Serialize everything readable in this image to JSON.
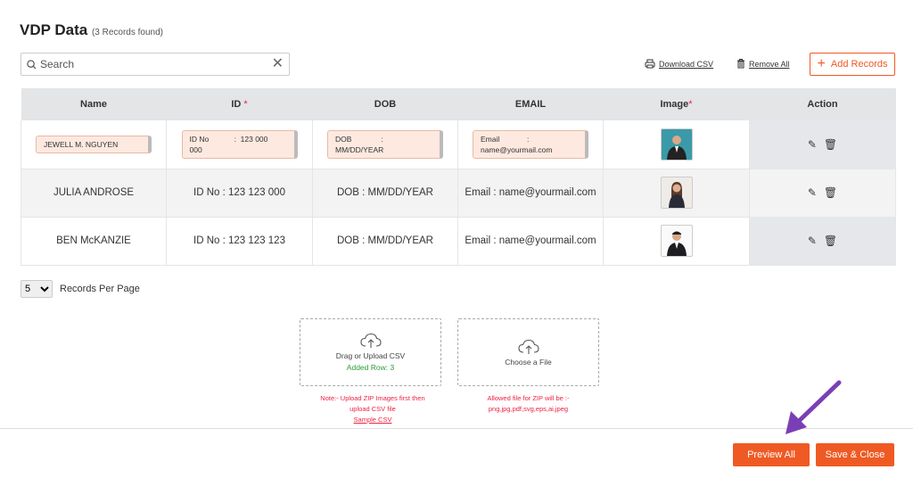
{
  "modal": {
    "title": "VDP Data",
    "record_count": "(3 Records found)",
    "close_glyph": "ˇ"
  },
  "search": {
    "placeholder": "Search"
  },
  "toolbar": {
    "download_csv": "Download CSV",
    "remove_all": "Remove All",
    "add_records": "Add Records"
  },
  "table": {
    "headers": {
      "name": "Name",
      "id": "ID",
      "dob": "DOB",
      "email": "EMAIL",
      "image": "Image",
      "action": "Action"
    },
    "required_mark": "*",
    "edit_row": {
      "name": "JEWELL M. NGUYEN",
      "id_line1": "ID No            :  123 000",
      "id_line2": "000",
      "dob_line1": "DOB              :",
      "dob_line2": "MM/DD/YEAR",
      "email_line1": "Email             :",
      "email_line2": "name@yourmail.com"
    },
    "rows": [
      {
        "name": "JULIA ANDROSE",
        "id": "ID No : 123 123 000",
        "dob": "DOB : MM/DD/YEAR",
        "email": "Email : name@yourmail.com"
      },
      {
        "name": "BEN McKANZIE",
        "id": "ID No : 123 123 123",
        "dob": "DOB : MM/DD/YEAR",
        "email": "Email : name@yourmail.com"
      }
    ]
  },
  "pagination": {
    "selected": "5",
    "label": "Records Per Page"
  },
  "upload_csv": {
    "label": "Drag or Upload CSV",
    "status": "Added Row: 3",
    "note_line1": "Note:- Upload ZIP Images first then",
    "note_line2": "upload CSV file",
    "sample_link": "Sample CSV"
  },
  "upload_zip": {
    "label": "Choose a File",
    "note_line1": "Allowed file for ZIP will be :-",
    "note_line2": "png,jpg,pdf,svg,eps,ai,jpeg"
  },
  "footer": {
    "preview_all": "Preview All",
    "save_close": "Save & Close"
  },
  "colors": {
    "accent": "#ef5a24",
    "annotation_arrow": "#7b3fb5",
    "success": "#2a9d3b"
  }
}
